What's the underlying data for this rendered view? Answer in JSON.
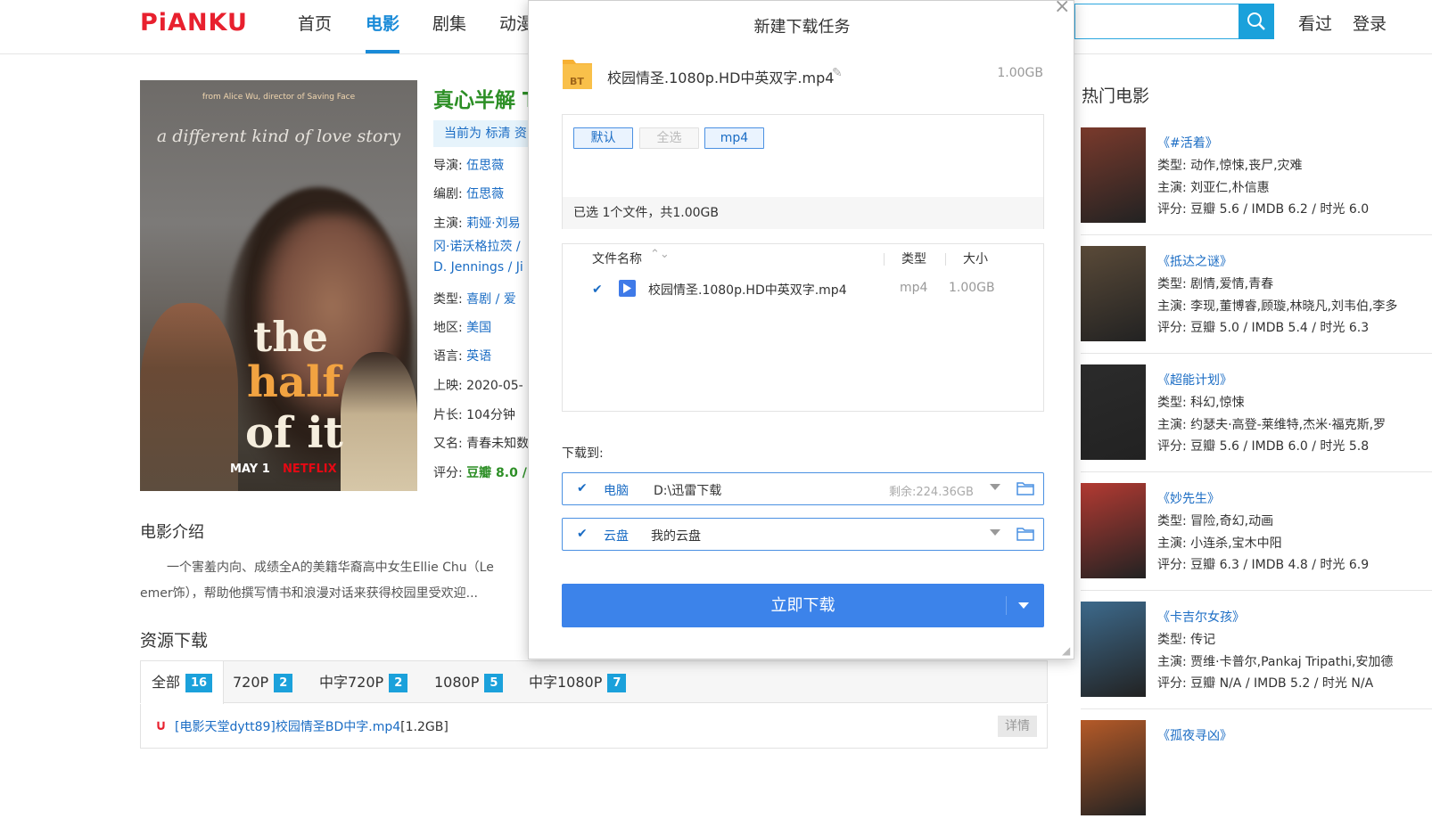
{
  "header": {
    "logo": "PiANKU",
    "nav": [
      "首页",
      "电影",
      "剧集",
      "动漫"
    ],
    "search_placeholder": "",
    "links": [
      "看过",
      "登录"
    ]
  },
  "poster": {
    "director_credit": "from Alice Wu, director of Saving Face",
    "tagline": "a different kind of love story",
    "title_lines": [
      "the",
      "half",
      "of it"
    ],
    "release": "MAY 1",
    "brand": "NETFLIX"
  },
  "movie": {
    "title": "真心半解 T",
    "quality_bar": "当前为 标清 资",
    "rows": [
      {
        "label": "导演:",
        "value": "伍思薇"
      },
      {
        "label": "编剧:",
        "value": "伍思薇"
      },
      {
        "label": "主演:",
        "value": "莉娅·刘易"
      },
      {
        "label": "",
        "value": "冈·诺沃格拉茨 /"
      },
      {
        "label": "",
        "value": "D. Jennings / Ji"
      },
      {
        "label": "类型:",
        "value": "喜剧 / 爱"
      },
      {
        "label": "地区:",
        "value": "美国"
      },
      {
        "label": "语言:",
        "value": "英语"
      },
      {
        "label": "上映:",
        "value": "2020-05-"
      },
      {
        "label": "片长:",
        "value": "104分钟"
      },
      {
        "label": "又名:",
        "value": "青春未知数"
      },
      {
        "label": "评分:",
        "value": "豆瓣 8.0 /"
      }
    ]
  },
  "intro": {
    "heading": "电影介绍",
    "text": "一个害羞内向、成绩全A的美籍华裔高中女生Ellie Chu（Le emer饰），帮助他撰写情书和浪漫对话来获得校园里受欢迎..."
  },
  "resources": {
    "heading": "资源下载",
    "tabs": [
      {
        "label": "全部",
        "count": "16"
      },
      {
        "label": "720P",
        "count": "2"
      },
      {
        "label": "中字720P",
        "count": "2"
      },
      {
        "label": "1080P",
        "count": "5"
      },
      {
        "label": "中字1080P",
        "count": "7"
      }
    ],
    "row": {
      "link": "[电影天堂dytt89]校园情圣BD中字.mp4",
      "size": "[1.2GB]",
      "detail": "详情"
    }
  },
  "hot": {
    "heading": "热门电影",
    "items": [
      {
        "name": "《#活着》",
        "type": "类型: 动作,惊悚,丧尸,灾难",
        "cast": "主演: 刘亚仁,朴信惠",
        "score": "评分: 豆瓣 5.6 / IMDB 6.2 / 时光 6.0",
        "thumb_color": "#7a3a2c"
      },
      {
        "name": "《抵达之谜》",
        "type": "类型: 剧情,爱情,青春",
        "cast": "主演: 李现,董博睿,顾璇,林晓凡,刘韦伯,李多",
        "score": "评分: 豆瓣 5.0 / IMDB 5.4 / 时光 6.3",
        "thumb_color": "#5a4a38"
      },
      {
        "name": "《超能计划》",
        "type": "类型: 科幻,惊悚",
        "cast": "主演: 约瑟夫·高登-莱维特,杰米·福克斯,罗",
        "score": "评分: 豆瓣 5.6 / IMDB 6.0 / 时光 5.8",
        "thumb_color": "#2b2b2b"
      },
      {
        "name": "《妙先生》",
        "type": "类型: 冒险,奇幻,动画",
        "cast": "主演: 小连杀,宝木中阳",
        "score": "评分: 豆瓣 6.3 / IMDB 4.8 / 时光 6.9",
        "thumb_color": "#b33a32"
      },
      {
        "name": "《卡吉尔女孩》",
        "type": "类型: 传记",
        "cast": "主演: 贾维·卡普尔,Pankaj Tripathi,安加德",
        "score": "评分: 豆瓣 N/A / IMDB 5.2 / 时光 N/A",
        "thumb_color": "#3d6a8c"
      },
      {
        "name": "《孤夜寻凶》",
        "type": "",
        "cast": "",
        "score": "",
        "thumb_color": "#b55a28"
      }
    ]
  },
  "dialog": {
    "title": "新建下载任务",
    "close": "×",
    "file_badge": "BT",
    "file_name": "校园情圣.1080p.HD中英双字.mp4",
    "file_size": "1.00GB",
    "filters": [
      "默认",
      "全选",
      "mp4"
    ],
    "summary": "已选 1个文件，共1.00GB",
    "table": {
      "col_name": "文件名称",
      "col_type": "类型",
      "col_size": "大小",
      "rows": [
        {
          "name": "校园情圣.1080p.HD中英双字.mp4",
          "type": "mp4",
          "size": "1.00GB"
        }
      ]
    },
    "download_to": "下载到:",
    "destinations": [
      {
        "label": "电脑",
        "path": "D:\\迅雷下载",
        "remain": "剩余:224.36GB"
      },
      {
        "label": "云盘",
        "path": "我的云盘",
        "remain": ""
      }
    ],
    "download_button": "立即下载"
  }
}
